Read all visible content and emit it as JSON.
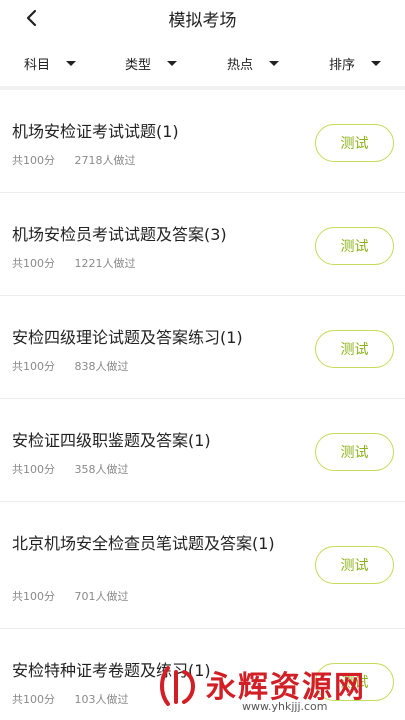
{
  "header": {
    "title": "模拟考场",
    "back_icon": "chevron-left-icon"
  },
  "filters": [
    {
      "label": "科目"
    },
    {
      "label": "类型"
    },
    {
      "label": "热点"
    },
    {
      "label": "排序"
    }
  ],
  "exams": [
    {
      "title": "机场安检证考试试题(1)",
      "total": "共100分",
      "takers": "2718人做过",
      "button": "测试"
    },
    {
      "title": "机场安检员考试试题及答案(3)",
      "total": "共100分",
      "takers": "1221人做过",
      "button": "测试"
    },
    {
      "title": "安检四级理论试题及答案练习(1)",
      "total": "共100分",
      "takers": "838人做过",
      "button": "测试"
    },
    {
      "title": "安检证四级职鉴题及答案(1)",
      "total": "共100分",
      "takers": "358人做过",
      "button": "测试"
    },
    {
      "title": "北京机场安全检查员笔试题及答案(1)",
      "total": "共100分",
      "takers": "701人做过",
      "button": "测试"
    },
    {
      "title": "安检特种证考卷题及练习(1)",
      "total": "共100分",
      "takers": "103人做过",
      "button": "测试"
    }
  ],
  "watermark": {
    "text": "永辉资源网",
    "url": "www.yhkjjj.com"
  },
  "colors": {
    "accent": "#8cb21a",
    "accent_border": "#c3dc5a",
    "watermark": "#d21f26"
  }
}
